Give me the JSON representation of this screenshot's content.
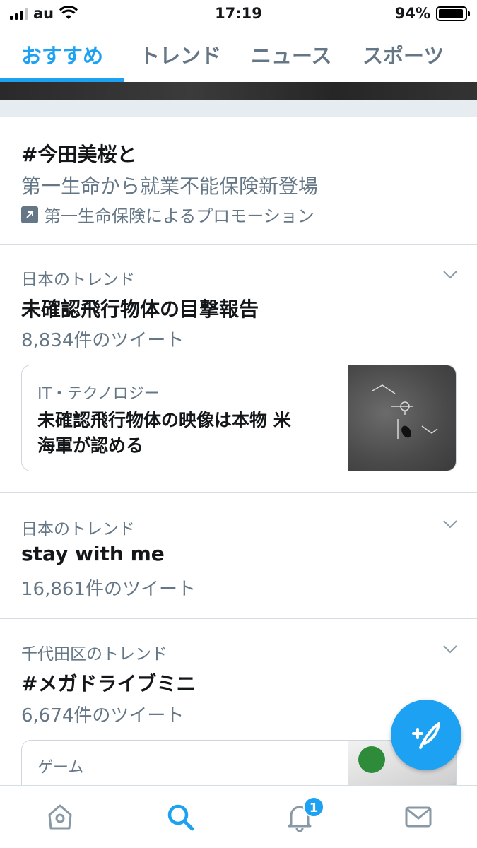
{
  "status_bar": {
    "carrier": "au",
    "time": "17:19",
    "battery": "94%",
    "battery_level": 0.94
  },
  "tabs": [
    {
      "label": "おすすめ",
      "active": true
    },
    {
      "label": "トレンド",
      "active": false
    },
    {
      "label": "ニュース",
      "active": false
    },
    {
      "label": "スポーツ",
      "active": false
    }
  ],
  "promoted": {
    "hashtag": "#今田美桜と",
    "description": "第一生命から就業不能保険新登場",
    "promoted_by": "第一生命保険によるプロモーション"
  },
  "trends": [
    {
      "context": "日本のトレンド",
      "name": "未確認飛行物体の目撃報告",
      "count": "8,834件のツイート",
      "card": {
        "category": "IT・テクノロジー",
        "headline_line1": "未確認飛行物体の映像は本物 米",
        "headline_line2": "海軍が認める"
      }
    },
    {
      "context": "日本のトレンド",
      "name": "stay with me",
      "count": "16,861件のツイート"
    },
    {
      "context": "千代田区のトレンド",
      "name": "#メガドライブミニ",
      "count": "6,674件のツイート",
      "card": {
        "category": "ゲーム"
      }
    }
  ],
  "bottom_nav": {
    "items": [
      "home-icon",
      "search-icon",
      "bell-icon",
      "mail-icon"
    ],
    "notification_badge": "1"
  },
  "colors": {
    "accent": "#1da1f2",
    "secondary_text": "#657786",
    "divider": "#d6dde3",
    "section_gap": "#e6ecf0"
  }
}
